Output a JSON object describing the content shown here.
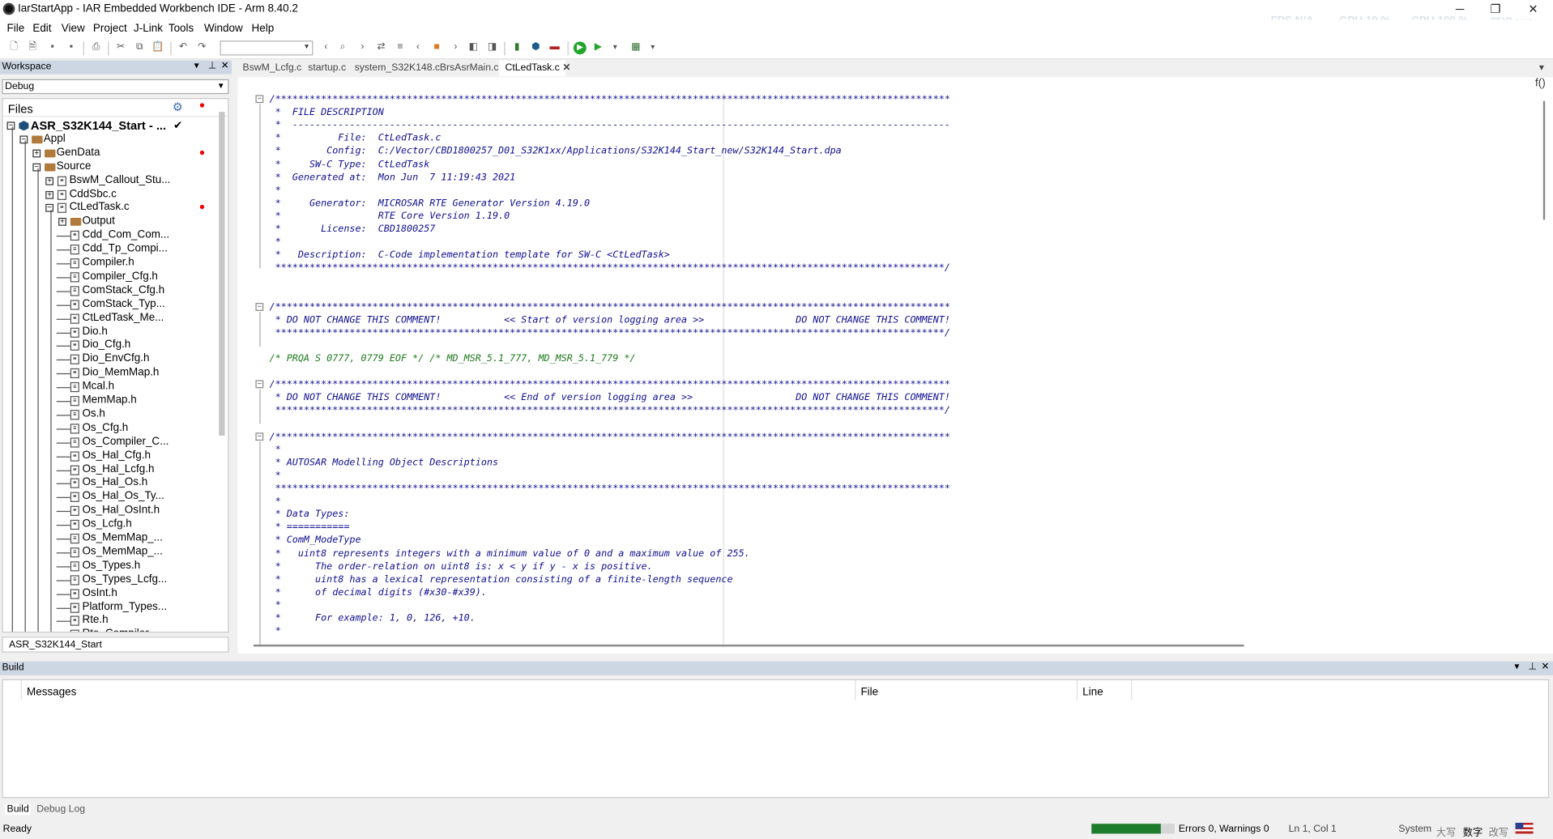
{
  "window": {
    "title": "IarStartApp - IAR Embedded Workbench IDE - Arm 8.40.2",
    "hud": {
      "fps": "FPS N/A",
      "gpu": "GPU 19 %",
      "cpu": "CPU 100 %",
      "extra": "延迟 N/A"
    },
    "controls": {
      "minimize": "─",
      "restore": "❐",
      "close": "✕"
    }
  },
  "menu": [
    "File",
    "Edit",
    "View",
    "Project",
    "J-Link",
    "Tools",
    "Window",
    "Help"
  ],
  "workspace": {
    "header": "Workspace",
    "config": "Debug",
    "files_label": "Files",
    "project_tab": "ASR_S32K144_Start",
    "tree": [
      {
        "label": "ASR_S32K144_Start - ...",
        "bold": true,
        "mark": "check"
      },
      {
        "label": "Appl"
      },
      {
        "label": "GenData",
        "dot": true
      },
      {
        "label": "Source"
      },
      {
        "label": "BswM_Callout_Stu..."
      },
      {
        "label": "CddSbc.c"
      },
      {
        "label": "CtLedTask.c",
        "dot": true
      },
      {
        "label": "Output"
      },
      {
        "label": "Cdd_Com_Com..."
      },
      {
        "label": "Cdd_Tp_Compi..."
      },
      {
        "label": "Compiler.h"
      },
      {
        "label": "Compiler_Cfg.h"
      },
      {
        "label": "ComStack_Cfg.h"
      },
      {
        "label": "ComStack_Typ..."
      },
      {
        "label": "CtLedTask_Me..."
      },
      {
        "label": "Dio.h"
      },
      {
        "label": "Dio_Cfg.h"
      },
      {
        "label": "Dio_EnvCfg.h"
      },
      {
        "label": "Dio_MemMap.h"
      },
      {
        "label": "Mcal.h"
      },
      {
        "label": "MemMap.h"
      },
      {
        "label": "Os.h"
      },
      {
        "label": "Os_Cfg.h"
      },
      {
        "label": "Os_Compiler_C..."
      },
      {
        "label": "Os_Hal_Cfg.h"
      },
      {
        "label": "Os_Hal_Lcfg.h"
      },
      {
        "label": "Os_Hal_Os.h"
      },
      {
        "label": "Os_Hal_Os_Ty..."
      },
      {
        "label": "Os_Hal_OsInt.h"
      },
      {
        "label": "Os_Lcfg.h"
      },
      {
        "label": "Os_MemMap_..."
      },
      {
        "label": "Os_MemMap_..."
      },
      {
        "label": "Os_Types.h"
      },
      {
        "label": "Os_Types_Lcfg..."
      },
      {
        "label": "OsInt.h"
      },
      {
        "label": "Platform_Types..."
      },
      {
        "label": "Rte.h"
      },
      {
        "label": "Rte_Compiler..."
      }
    ]
  },
  "editor": {
    "tabs": [
      "BswM_Lcfg.c",
      "startup.c",
      "system_S32K148.c",
      "BrsAsrMain.c",
      "CtLedTask.c"
    ],
    "active_tab": "CtLedTask.c",
    "func_button": "f()",
    "lines": [
      "/**********************************************************************************************************************",
      " *  FILE DESCRIPTION",
      " *  -------------------------------------------------------------------------------------------------------------------",
      " *          File:  CtLedTask.c",
      " *        Config:  C:/Vector/CBD1800257_D01_S32K1xx/Applications/S32K144_Start_new/S32K144_Start.dpa",
      " *     SW-C Type:  CtLedTask",
      " *  Generated at:  Mon Jun  7 11:19:43 2021",
      " *",
      " *     Generator:  MICROSAR RTE Generator Version 4.19.0",
      " *                 RTE Core Version 1.19.0",
      " *       License:  CBD1800257",
      " *",
      " *   Description:  C-Code implementation template for SW-C <CtLedTask>",
      " *********************************************************************************************************************/",
      "",
      "",
      "/**********************************************************************************************************************",
      " * DO NOT CHANGE THIS COMMENT!           << Start of version logging area >>                DO NOT CHANGE THIS COMMENT!",
      " *********************************************************************************************************************/",
      "",
      "/* PRQA S 0777, 0779 EOF */ /* MD_MSR_5.1_777, MD_MSR_5.1_779 */",
      "",
      "/**********************************************************************************************************************",
      " * DO NOT CHANGE THIS COMMENT!           << End of version logging area >>                  DO NOT CHANGE THIS COMMENT!",
      " *********************************************************************************************************************/",
      "",
      "/**********************************************************************************************************************",
      " *",
      " * AUTOSAR Modelling Object Descriptions",
      " *",
      " **********************************************************************************************************************",
      " *",
      " * Data Types:",
      " * ===========",
      " * ComM_ModeType",
      " *   uint8 represents integers with a minimum value of 0 and a maximum value of 255.",
      " *      The order-relation on uint8 is: x < y if y - x is positive.",
      " *      uint8 has a lexical representation consisting of a finite-length sequence",
      " *      of decimal digits (#x30-#x39).",
      " *",
      " *      For example: 1, 0, 126, +10.",
      " *"
    ]
  },
  "build": {
    "header": "Build",
    "columns": [
      "Messages",
      "File",
      "Line"
    ],
    "tabs": [
      "Build",
      "Debug Log"
    ]
  },
  "status": {
    "ready": "Ready",
    "progress": 0.83,
    "errors": "Errors 0, Warnings 0",
    "position": "Ln 1, Col 1",
    "system": "System",
    "ime1": "大写",
    "ime2": "数字",
    "ime3": "改写"
  }
}
